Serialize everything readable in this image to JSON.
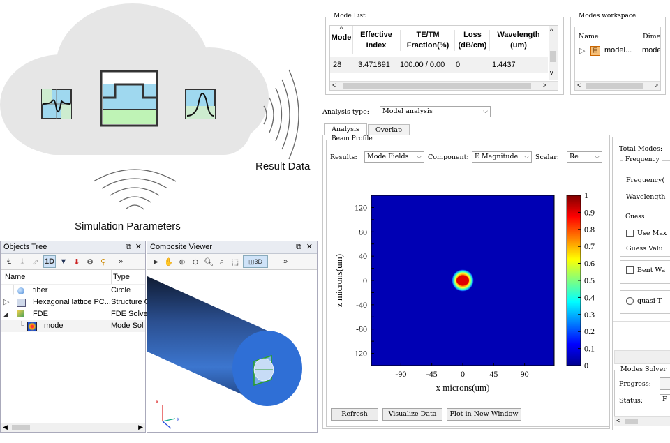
{
  "labels": {
    "result_data": "Result Data",
    "simulation_parameters": "Simulation Parameters"
  },
  "objects_tree": {
    "title": "Objects Tree",
    "columns": [
      "Name",
      "Type"
    ],
    "rows": [
      {
        "name": "fiber",
        "type": "Circle",
        "icon": "sphere-icon"
      },
      {
        "name": "Hexagonal lattice PC...",
        "type": "Structure G",
        "icon": "lattice-icon"
      },
      {
        "name": "FDE",
        "type": "FDE Solve",
        "icon": "fde-icon"
      },
      {
        "name": "mode",
        "type": "Mode Sol",
        "icon": "mode-icon"
      }
    ]
  },
  "composite_viewer": {
    "title": "Composite Viewer",
    "view_3d_label": "3D",
    "axes": {
      "x": "x",
      "y": "y",
      "z": "z"
    }
  },
  "mode_list": {
    "title": "Mode List",
    "headers": [
      "Mode",
      "Effective Index",
      "TE/TM Fraction(%)",
      "Loss (dB/cm)",
      "Wavelength (um)"
    ],
    "header_lines": [
      [
        "Mode"
      ],
      [
        "Effective",
        "Index"
      ],
      [
        "TE/TM",
        "Fraction(%)"
      ],
      [
        "Loss",
        "(dB/cm)"
      ],
      [
        "Wavelength",
        "(um)"
      ]
    ],
    "row": {
      "mode": "28",
      "effective_index": "3.471891",
      "fraction": "100.00 / 0.00",
      "loss": "0",
      "wavelength": "1.4437"
    }
  },
  "modes_workspace": {
    "title": "Modes workspace",
    "columns": [
      "Name",
      "Dimen"
    ],
    "row": {
      "name": "model...",
      "dim": "mode"
    }
  },
  "analysis": {
    "type_label": "Analysis type:",
    "type_value": "Model analysis",
    "tabs": [
      "Analysis",
      "Overlap"
    ],
    "beam_profile_title": "Beam Profile",
    "results_label": "Results:",
    "results_value": "Mode Fields",
    "component_label": "Component:",
    "component_value": "E Magnitude",
    "scalar_label": "Scalar:",
    "scalar_value": "Re",
    "buttons": [
      "Refresh",
      "Visualize Data",
      "Plot in New Window"
    ]
  },
  "side_panel": {
    "total_modes": "Total Modes:",
    "frequency": "Frequency",
    "frequency_field": "Frequency(",
    "wavelength_field": "Wavelength",
    "guess": "Guess",
    "use_max": "Use Max",
    "guess_value": "Guess Valu",
    "bent": "Bent Wa",
    "quasi": "quasi-T",
    "modes_solver": "Modes Solver",
    "progress": "Progress:",
    "status": "Status:",
    "status_value": "F"
  },
  "chart_data": {
    "type": "heatmap",
    "xlabel": "x microns(um)",
    "ylabel": "z microns(um)",
    "x_ticks": [
      -90,
      -45,
      0,
      45,
      90
    ],
    "y_ticks": [
      120,
      100,
      80,
      60,
      40,
      20,
      0,
      -20,
      -40,
      -60,
      -80,
      -100,
      -120
    ],
    "y_tick_labels_shown": [
      120,
      80,
      40,
      0,
      -40,
      -80,
      -120
    ],
    "xlim": [
      -133,
      133
    ],
    "ylim": [
      -140,
      140
    ],
    "colorbar": {
      "min": 0,
      "max": 1,
      "ticks": [
        0,
        0.1,
        0.2,
        0.3,
        0.4,
        0.5,
        0.6,
        0.7,
        0.8,
        0.9,
        1
      ],
      "colormap": "jet"
    },
    "hotspot": {
      "x": 0,
      "z": 0,
      "peak": 1
    }
  },
  "colors": {
    "panel_title_bg": "#e9ecf2",
    "plot_bg": "#0000b4",
    "fiber_blue": "#2f6fd6",
    "cloud": "#e5e5e5"
  }
}
